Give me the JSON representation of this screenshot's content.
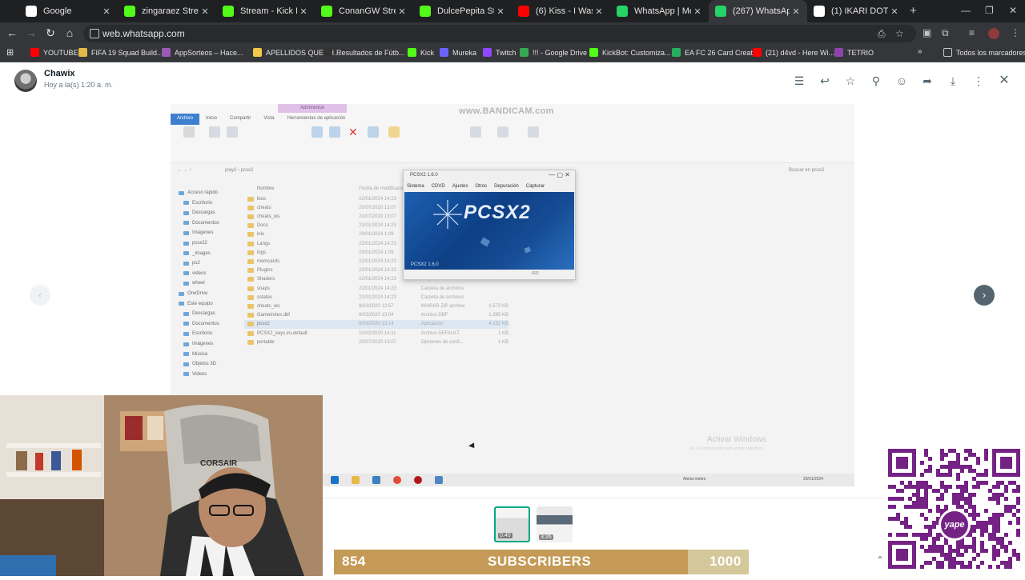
{
  "browser": {
    "tabs": [
      {
        "title": "Google",
        "fav_color": "#ffffff",
        "active": false
      },
      {
        "title": "zingaraez Stream - K",
        "fav_color": "#53fc18",
        "active": false
      },
      {
        "title": "Stream - Kick Dashbo",
        "fav_color": "#53fc18",
        "active": false
      },
      {
        "title": "ConanGW Stream - K",
        "fav_color": "#53fc18",
        "active": false
      },
      {
        "title": "DulcePepita Stream",
        "fav_color": "#53fc18",
        "active": false
      },
      {
        "title": "(6) Kiss - I Was Made",
        "fav_color": "#ff0000",
        "active": false
      },
      {
        "title": "WhatsApp | Mensaje",
        "fav_color": "#25d366",
        "active": false
      },
      {
        "title": "(267) WhatsApp",
        "fav_color": "#25d366",
        "active": true
      },
      {
        "title": "(1) IKARI DOTA on X",
        "fav_color": "#ffffff",
        "active": false
      }
    ],
    "url": "web.whatsapp.com",
    "bookmarks": [
      {
        "label": "YOUTUBE",
        "color": "#ff0000"
      },
      {
        "label": "FIFA 19 Squad Build...",
        "color": "#e5b84a"
      },
      {
        "label": "AppSorteos – Hace...",
        "color": "#9b59b6"
      },
      {
        "label": "APELLIDOS QUECH...",
        "color": "#f2c94c"
      },
      {
        "label": "Resultados de Fútb...",
        "color": "#333333"
      },
      {
        "label": "Kick",
        "color": "#53fc18"
      },
      {
        "label": "Mureka",
        "color": "#6c63ff"
      },
      {
        "label": "Twitch",
        "color": "#9146ff"
      },
      {
        "label": "!!! - Google Drive",
        "color": "#34a853"
      },
      {
        "label": "KickBot: Customiza...",
        "color": "#53fc18"
      },
      {
        "label": "EA FC 26 Card Creat...",
        "color": "#27ae60"
      },
      {
        "label": "(21) d4vd - Here Wi...",
        "color": "#ff0000"
      },
      {
        "label": "TETRIO",
        "color": "#8e44ad"
      }
    ],
    "all_bookmarks": "Todos los marcadores"
  },
  "viewer": {
    "sender": "Chawix",
    "timestamp": "Hoy a la(s) 1:20 a. m."
  },
  "media": {
    "watermark": "www.BANDICAM.com",
    "ribbon_tabs": [
      "Archivo",
      "Inicio",
      "Compartir",
      "Vista",
      "Herramientas de aplicación"
    ],
    "manage_tab": "Administrar",
    "path": "play2 › pcsx2",
    "search_placeholder": "Buscar en pcsx2",
    "sidebar": [
      "Acceso rápido",
      "Escritorio",
      "Descargas",
      "Documentos",
      "Imágenes",
      "pcsx22",
      "_images",
      "ps2",
      "videos",
      "wheel",
      "OneDrive",
      "Este equipo",
      "Descargas",
      "Documentos",
      "Escritorio",
      "Imágenes",
      "Música",
      "Objetos 3D",
      "Videos"
    ],
    "files": [
      {
        "name": "bios",
        "date": "22/01/2024 14:23",
        "type": "",
        "size": ""
      },
      {
        "name": "cheats",
        "date": "20/07/2020 13:07",
        "type": "",
        "size": ""
      },
      {
        "name": "cheats_ws",
        "date": "20/07/2020 13:07",
        "type": "",
        "size": ""
      },
      {
        "name": "Docs",
        "date": "22/01/2024 14:23",
        "type": "",
        "size": ""
      },
      {
        "name": "inis",
        "date": "29/01/2024 1:09",
        "type": "",
        "size": ""
      },
      {
        "name": "Langs",
        "date": "22/01/2024 14:23",
        "type": "",
        "size": ""
      },
      {
        "name": "logs",
        "date": "29/01/2024 1:09",
        "type": "",
        "size": ""
      },
      {
        "name": "memcards",
        "date": "22/01/2024 14:23",
        "type": "",
        "size": ""
      },
      {
        "name": "Plugins",
        "date": "22/01/2024 14:23",
        "type": "",
        "size": ""
      },
      {
        "name": "Shaders",
        "date": "22/01/2024 14:23",
        "type": "Carpeta de archivos",
        "size": ""
      },
      {
        "name": "snaps",
        "date": "22/01/2024 14:23",
        "type": "Carpeta de archivos",
        "size": ""
      },
      {
        "name": "sstates",
        "date": "22/01/2024 14:23",
        "type": "Carpeta de archivos",
        "size": ""
      },
      {
        "name": "cheats_ws",
        "date": "8/03/2020 12:57",
        "type": "WinRAR ZIP archive",
        "size": "1.573 KB"
      },
      {
        "name": "GameIndex.dbf",
        "date": "8/03/2020 13:04",
        "type": "Archivo DBF",
        "size": "1.395 KB"
      },
      {
        "name": "pcsx2",
        "date": "8/03/2020 13:14",
        "type": "Aplicación",
        "size": "4.152 KB"
      },
      {
        "name": "PCSX2_keys.ini.default",
        "date": "10/02/2020 14:11",
        "type": "Archivo DEFAULT",
        "size": "1 KB"
      },
      {
        "name": "portable",
        "date": "20/07/2020 13:07",
        "type": "Opciones de confi...",
        "size": "1 KB"
      }
    ],
    "pcsx2": {
      "title": "PCSX2 1.6.0",
      "menu": [
        "Sistema",
        "CDVD",
        "Ajustes",
        "Otros",
        "Depuración",
        "Capturar"
      ],
      "logo": "PCSX2",
      "status": "ISO"
    },
    "activate_windows": "Activar Windows",
    "activate_windows_sub": "Ve a Configuración para activar Windows.",
    "weather": "Alerta meteo",
    "clock": "29/01/2024"
  },
  "thumbnails": [
    {
      "duration": "0:40",
      "selected": true
    },
    {
      "duration": "3:26",
      "selected": false
    }
  ],
  "overlay": {
    "sub_count": "854",
    "sub_label": "SUBSCRIBERS",
    "sub_goal": "1000",
    "sub_progress": 0.854,
    "yape": "yape"
  },
  "colors": {
    "chrome_dark": "#35363a",
    "whatsapp_icon": "#54656f",
    "sub_fill": "#c49a56",
    "yape_purple": "#742284"
  }
}
